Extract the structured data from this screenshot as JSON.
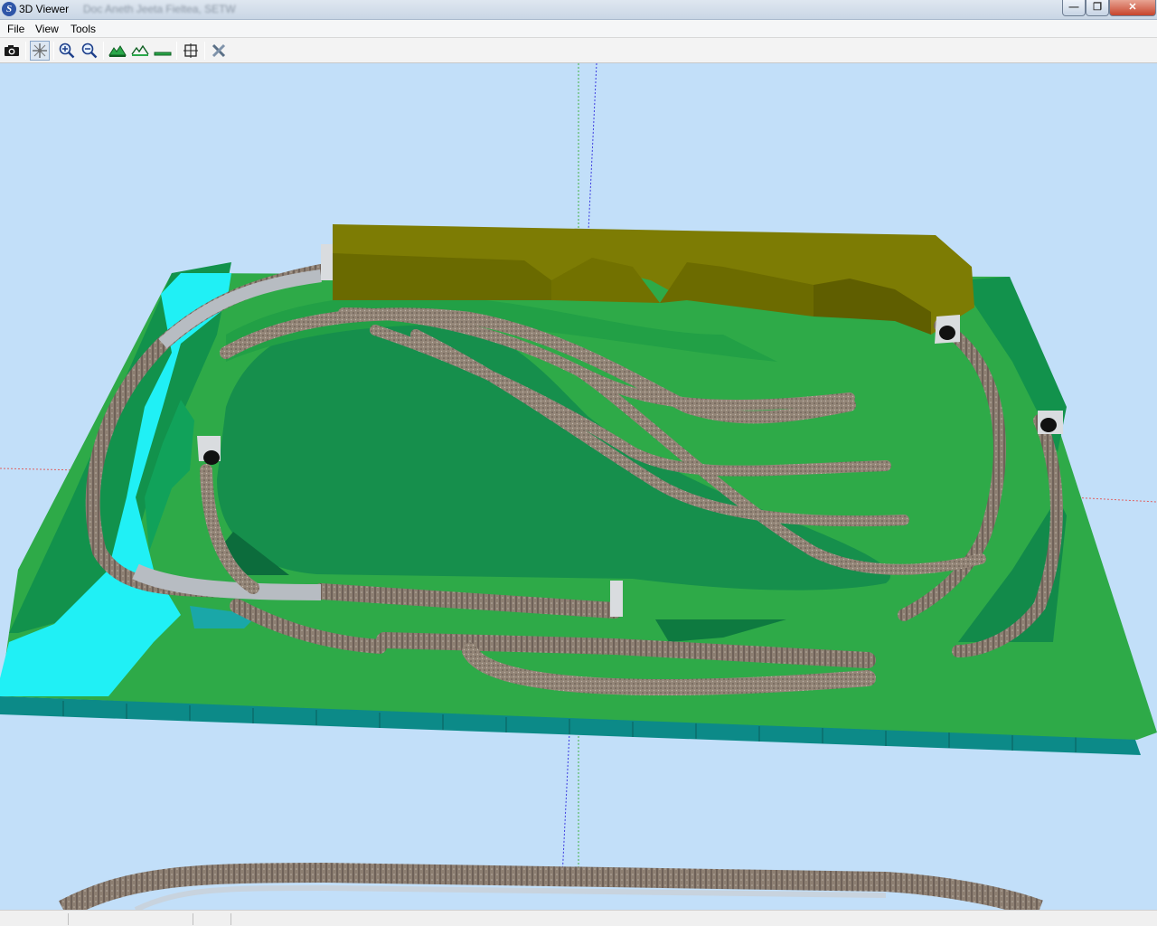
{
  "window": {
    "title": "3D Viewer",
    "app_icon_letter": "S",
    "file_path_blurred": "Doc Aneth Jeeta Fieltea, SETW",
    "controls": {
      "minimize": "—",
      "maximize": "❐",
      "close": "✕"
    }
  },
  "menu": {
    "items": [
      "File",
      "View",
      "Tools"
    ]
  },
  "toolbar": {
    "buttons": [
      {
        "icon": "camera-icon",
        "tooltip": ""
      },
      {
        "icon": "select-cursor-icon",
        "tooltip": ""
      },
      {
        "icon": "zoom-in-icon",
        "tooltip": ""
      },
      {
        "icon": "zoom-out-icon",
        "tooltip": ""
      },
      {
        "icon": "terrain-high-icon",
        "tooltip": ""
      },
      {
        "icon": "terrain-outline-icon",
        "tooltip": ""
      },
      {
        "icon": "terrain-flat-icon",
        "tooltip": ""
      },
      {
        "icon": "fit-view-icon",
        "tooltip": ""
      },
      {
        "icon": "tools-close-icon",
        "tooltip": ""
      }
    ]
  },
  "viewport": {
    "background": "#c2dff9",
    "colors": {
      "baseboard_top": "#2eac4a",
      "baseboard_side": "#0b8a86",
      "inner_field": "#168f4c",
      "water": "#1ff2f6",
      "hill": "#7d7c04",
      "hill_shade": "#6a6a00",
      "track_ballast": "#8e7f74",
      "track_bridge": "#b8bec4",
      "portal": "#d9dcdf"
    },
    "axes": {
      "y_axis": "#4cc24c",
      "x_axis": "#e86060",
      "z_axis": "#4a4af0"
    }
  }
}
